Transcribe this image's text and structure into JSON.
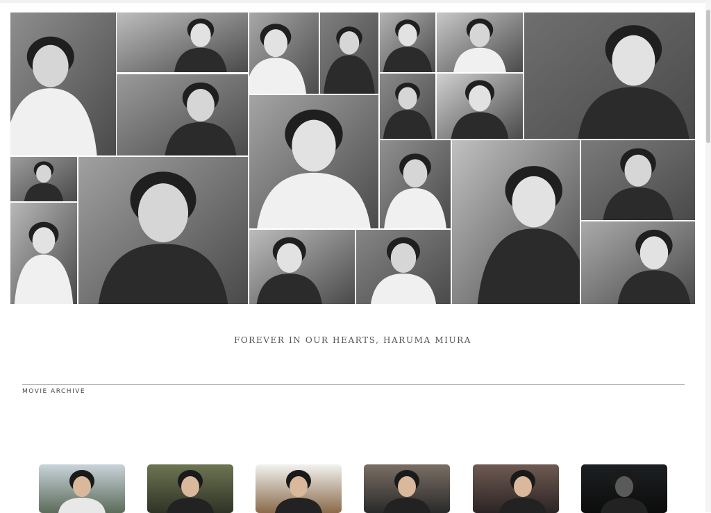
{
  "tagline": "FOREVER IN OUR HEARTS, HARUMA MIURA",
  "archive": {
    "title": "MOVIE ARCHIVE"
  },
  "colors": {
    "background": "#ffffff",
    "rule": "#9a9a9a",
    "text": "#555555"
  },
  "collage_photos": [
    "photo-portrait-smile",
    "photo-window-pointing",
    "photo-bookshelf-smile",
    "photo-profile-closeup",
    "photo-kimono",
    "photo-glasses",
    "photo-camera-seated",
    "photo-sea-laughing",
    "photo-bamboo-standing",
    "photo-eating",
    "photo-jacket-portrait",
    "photo-street-twirl",
    "photo-koala",
    "photo-wall-lean",
    "photo-forest-cardigan",
    "photo-wink",
    "photo-umbrella",
    "photo-looking-up",
    "photo-playground-sitting",
    "photo-train-seated"
  ],
  "movie_thumbs": [
    {
      "tone": "sky"
    },
    {
      "tone": "park"
    },
    {
      "tone": "glasses"
    },
    {
      "tone": "winter"
    },
    {
      "tone": "dark-pattern"
    },
    {
      "tone": "night"
    }
  ]
}
